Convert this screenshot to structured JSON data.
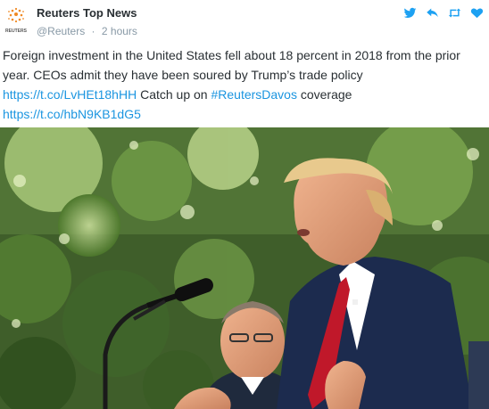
{
  "header": {
    "account_name": "Reuters Top News",
    "handle": "@Reuters",
    "separator": "·",
    "time": "2 hours",
    "avatar_text": "REUTERS"
  },
  "actions": {
    "icons": [
      "twitter-bird-icon",
      "reply-icon",
      "retweet-icon",
      "like-heart-icon"
    ],
    "accent": "#1da1f2"
  },
  "tweet": {
    "text_part1": "Foreign investment in the United States fell about 18 percent in 2018 from the prior year. CEOs admit they have been soured by Trump’s trade policy ",
    "link1": "https://t.co/LvHEt18hHH",
    "text_part2": " Catch up on ",
    "hashtag": "#ReutersDavos",
    "text_part3": " coverage ",
    "link2": "https://t.co/hbN9KB1dG5",
    "link_color": "#1b95e0"
  },
  "media": {
    "icon": "photo-image"
  }
}
